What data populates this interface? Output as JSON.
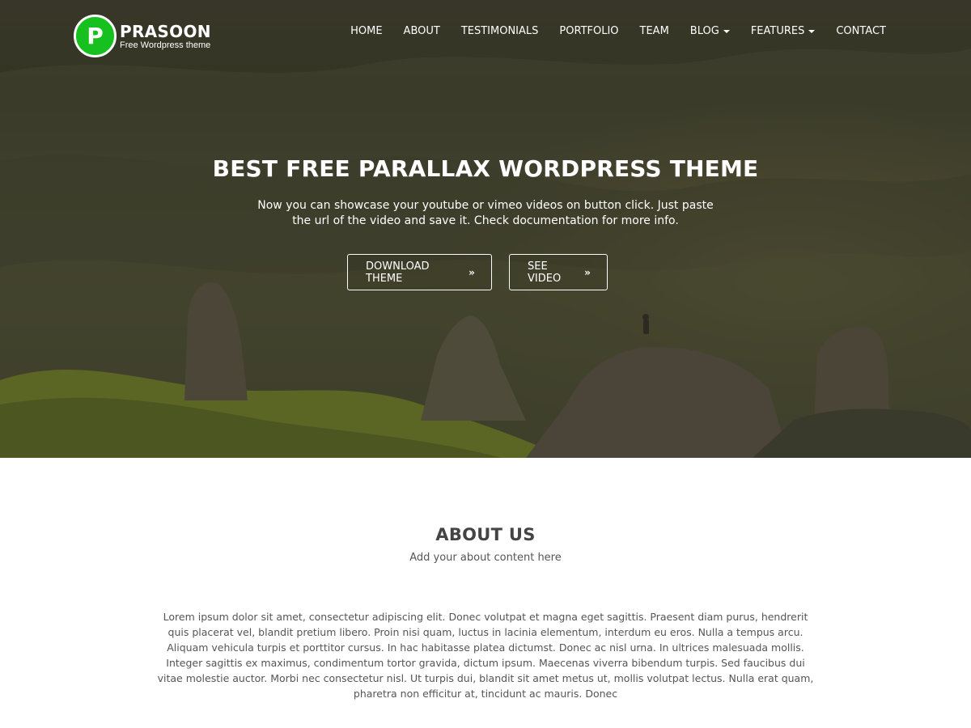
{
  "brand": {
    "badge_letter": "P",
    "name": "PRASOON",
    "tagline": "Free Wordpress theme",
    "accent_color": "#16c01e"
  },
  "nav": {
    "items": [
      {
        "label": "HOME"
      },
      {
        "label": "ABOUT"
      },
      {
        "label": "TESTIMONIALS"
      },
      {
        "label": "PORTFOLIO"
      },
      {
        "label": "TEAM"
      },
      {
        "label": "BLOG",
        "dropdown": true
      },
      {
        "label": "FEATURES",
        "dropdown": true
      },
      {
        "label": "CONTACT"
      }
    ]
  },
  "hero": {
    "title": "BEST FREE PARALLAX WORDPRESS THEME",
    "subtitle": "Now you can showcase your youtube or vimeo videos on button click. Just paste the url of the video and save it. Check documentation for more info.",
    "buttons": [
      {
        "label": "DOWNLOAD THEME",
        "icon": "double-chevron-right-icon"
      },
      {
        "label": "SEE VIDEO",
        "icon": "double-chevron-right-icon"
      }
    ]
  },
  "about": {
    "title_strong": "ABOUT",
    "title_light": "US",
    "subtitle": "Add your about content here",
    "body": "Lorem ipsum dolor sit amet, consectetur adipiscing elit. Donec volutpat et magna eget sagittis. Praesent diam purus, hendrerit quis placerat vel, blandit pretium libero. Proin nisi quam, luctus in lacinia elementum, interdum eu eros. Nulla a tempus arcu. Aliquam vehicula turpis et porttitor cursus. In hac habitasse platea dictumst. Donec ac nisl urna. In ultrices malesuada mollis. Integer sagittis ex maximus, condimentum tortor gravida, dictum ipsum. Maecenas viverra bibendum turpis. Sed faucibus dui vitae molestie auctor. Morbi nec consectetur nisl. Ut turpis dui, blandit sit amet metus ut, mollis volutpat lectus. Nulla erat quam, pharetra non efficitur at, tincidunt ac mauris. Donec"
  }
}
